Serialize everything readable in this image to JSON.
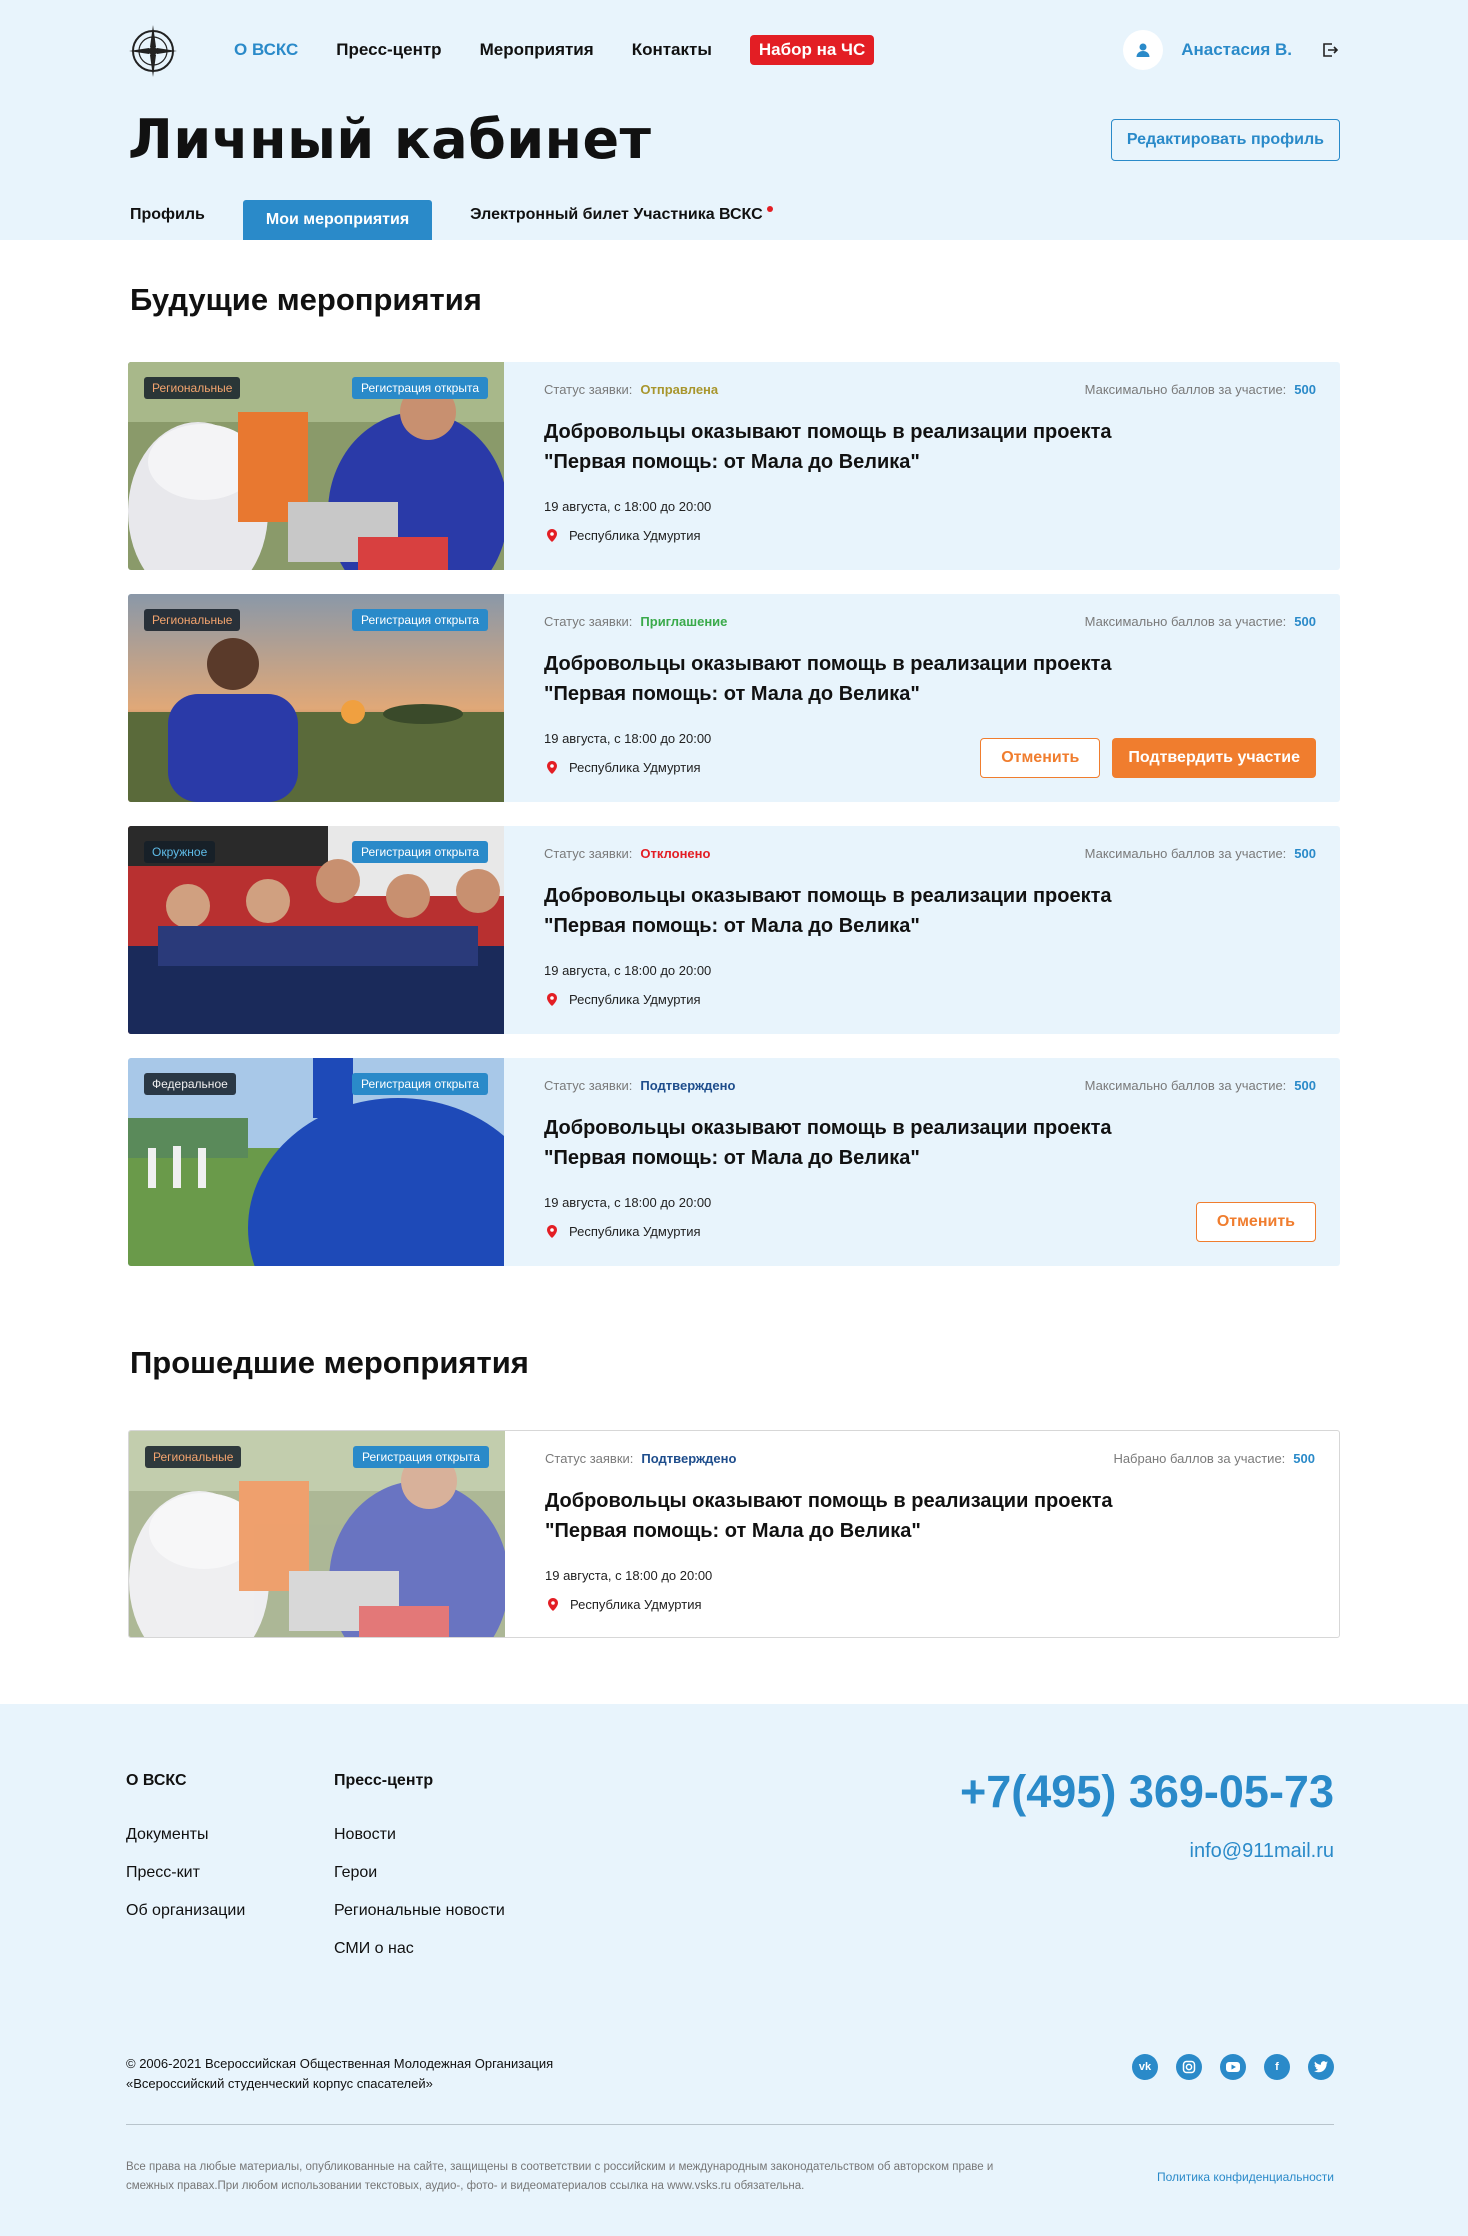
{
  "header": {
    "nav": [
      "О ВСКС",
      "Пресс-центр",
      "Мероприятия",
      "Контакты"
    ],
    "nabor_label": "Набор на ЧС",
    "user_name": "Анастасия В."
  },
  "page": {
    "title": "Личный кабинет",
    "edit_profile": "Редактировать профиль",
    "tabs": [
      "Профиль",
      "Мои мероприятия",
      "Электронный билет Участника ВСКС"
    ]
  },
  "future": {
    "title": "Будущие мероприятия",
    "cards": [
      {
        "scope": "Региональные",
        "registration": "Регистрация открыта",
        "status_label": "Статус заявки:",
        "status": "Отправлена",
        "points_label": "Максимально баллов за участие:",
        "points": "500",
        "title": "Добровольцы оказывают помощь в реализации проекта \"Первая помощь: от Мала до Велика\"",
        "date": "19 августа, с 18:00 до 20:00",
        "location": "Республика Удмуртия"
      },
      {
        "scope": "Региональные",
        "registration": "Регистрация открыта",
        "status_label": "Статус заявки:",
        "status": "Приглашение",
        "points_label": "Максимально баллов за участие:",
        "points": "500",
        "title": "Добровольцы оказывают помощь в реализации проекта \"Первая помощь: от Мала до Велика\"",
        "date": "19 августа, с 18:00 до 20:00",
        "location": "Республика Удмуртия",
        "cancel": "Отменить",
        "confirm": "Подтвердить участие"
      },
      {
        "scope": "Окружное",
        "registration": "Регистрация открыта",
        "status_label": "Статус заявки:",
        "status": "Отклонено",
        "points_label": "Максимально баллов за участие:",
        "points": "500",
        "title": "Добровольцы оказывают помощь в реализации проекта \"Первая помощь: от Мала до Велика\"",
        "date": "19 августа, с 18:00 до 20:00",
        "location": "Республика Удмуртия"
      },
      {
        "scope": "Федеральное",
        "registration": "Регистрация открыта",
        "status_label": "Статус заявки:",
        "status": "Подтверждено",
        "points_label": "Максимально баллов за участие:",
        "points": "500",
        "title": "Добровольцы оказывают помощь в реализации проекта \"Первая помощь: от Мала до Велика\"",
        "date": "19 августа, с 18:00 до 20:00",
        "location": "Республика Удмуртия",
        "cancel": "Отменить"
      }
    ]
  },
  "past": {
    "title": "Прошедшие мероприятия",
    "cards": [
      {
        "scope": "Региональные",
        "registration": "Регистрация открыта",
        "status_label": "Статус заявки:",
        "status": "Подтверждено",
        "points_label": "Набрано баллов за участие:",
        "points": "500",
        "title": "Добровольцы оказывают помощь в реализации проекта \"Первая помощь: от Мала до Велика\"",
        "date": "19 августа, с 18:00 до 20:00",
        "location": "Республика Удмуртия"
      }
    ]
  },
  "footer": {
    "col1_title": "О ВСКС",
    "col1_links": [
      "Документы",
      "Пресс-кит",
      "Об организации"
    ],
    "col2_title": "Пресс-центр",
    "col2_links": [
      "Новости",
      "Герои",
      "Региональные новости",
      "СМИ о нас"
    ],
    "phone": "+7(495) 369-05-73",
    "email": "info@911mail.ru",
    "copyright_1": "© 2006-2021 Всероссийская Общественная Молодежная Организация",
    "copyright_2": "«Всероссийский студенческий корпус спасателей»",
    "legal_1": "Все права на любые материалы, опубликованные на сайте, защищены в соответствии с российским и международным законодательством об авторском праве и",
    "legal_2": "смежных правах.При любом использовании текстовых, аудио-, фото- и видеоматериалов ссылка на www.vsks.ru обязательна.",
    "policy": "Политика конфиденциальности",
    "social_icons": [
      "vk-icon",
      "instagram-icon",
      "youtube-icon",
      "facebook-icon",
      "twitter-icon"
    ]
  },
  "colors": {
    "accent": "#2a8ac9",
    "header_bg": "#e8f4fc",
    "nabor_red": "#e31e24",
    "action_orange": "#f07d2e"
  }
}
